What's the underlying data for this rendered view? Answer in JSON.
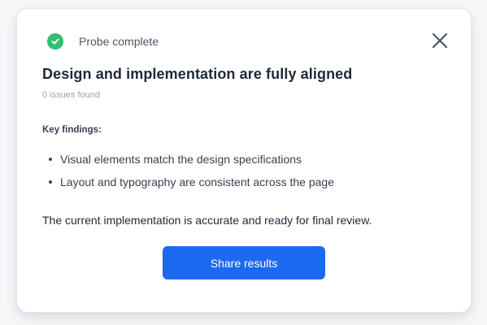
{
  "status": {
    "icon": "check-circle-icon",
    "text": "Probe complete",
    "color": "#2fbf71"
  },
  "close": {
    "icon": "close-icon"
  },
  "title": "Design and implementation are fully aligned",
  "subtitle": "0 issues found",
  "findings": {
    "label": "Key findings:",
    "items": [
      "Visual elements match the design specifications",
      "Layout and typography are consistent across the page"
    ]
  },
  "summary": "The current implementation is accurate and ready for final review.",
  "actions": {
    "share_label": "Share results",
    "accent": "#1d6af2"
  }
}
